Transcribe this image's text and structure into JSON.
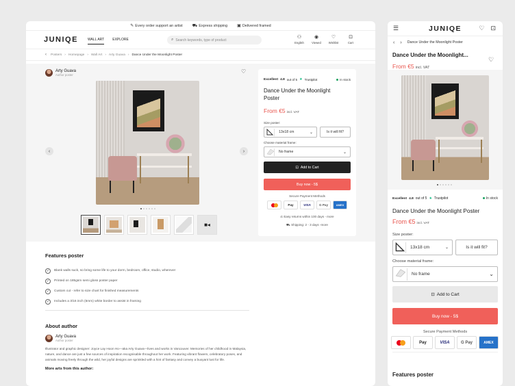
{
  "topbar": {
    "items": [
      {
        "icon": "brush-icon",
        "glyph": "✎",
        "label": "Every order support an artist"
      },
      {
        "icon": "truck-icon",
        "glyph": "⛟",
        "label": "Express shipping"
      },
      {
        "icon": "frame-icon",
        "glyph": "▣",
        "label": "Delivered framed"
      }
    ]
  },
  "nav": {
    "logo": "JUNIQE",
    "links": [
      "WALL ART",
      "EXPLORE"
    ],
    "search_placeholder": "Search keywords, type of product",
    "icons": [
      {
        "icon": "user-icon",
        "glyph": "👤",
        "label": "English"
      },
      {
        "icon": "eye-icon",
        "glyph": "◔",
        "label": "Viewed"
      },
      {
        "icon": "heart-icon",
        "glyph": "♡",
        "label": "Wishlist"
      },
      {
        "icon": "bag-icon",
        "glyph": "🛍",
        "label": "Cart"
      }
    ]
  },
  "breadcrumb": [
    "Posters",
    "Homepage",
    "Wall Art",
    "Arty Guava",
    "Dance Under the Moonlight Poster"
  ],
  "author": {
    "name": "Arty Guava",
    "role": "Author poster"
  },
  "gallery": {
    "dot_count": 6,
    "active_dot": 0,
    "thumb_count": 6
  },
  "buybox": {
    "trust_excellent": "Excellent",
    "trust_score": "4.8",
    "trust_out_of": "out of 5",
    "trust_brand": "Trustpilot",
    "stock": "In stock",
    "title": "Dance Under the Moonlight Poster",
    "price": "From €5",
    "price_note": "incl. VAT",
    "size_label": "Size poster:",
    "size_value": "13x18 cm",
    "size_help": "Is it will fit?",
    "frame_label": "Choose material frame:",
    "frame_value": "No frame",
    "add_to_cart": "Add to Cart",
    "buy_now": "Buy now - 5$",
    "payment_title": "Secure Payment Methods",
    "payments": [
      "Mastercard",
      "Apple Pay",
      "VISA",
      "G Pay",
      "AMEX"
    ],
    "returns": "Easy returns within 100 days - more",
    "shipping": "Shipping: 2 - 3 days -more"
  },
  "features": {
    "title": "Features poster",
    "items": [
      "Blank walls suck, so bring some life to your dorm, bedroom, office, studio, wherever",
      "Printed on 185gsm semi gloss poster paper",
      "Custom cut - refer to size chart for finished measurements",
      "Includes a 3/16 inch (5mm) white border to assist in framing"
    ]
  },
  "about": {
    "title": "About author",
    "name": "Arty Guava",
    "role": "Author poster",
    "bio": "Illustrator and graphic designer: Joyce Lay Hoon Ho—aka Arty Guava—lives and works in Vancouver. Memories of her childhood in Malaysia, nature, and dance are just a few sources of inspiration recognisable throughout her work. Featuring vibrant flowers, celebratory poses, and animals moving freely through the wild, her joyful designs are sprinkled with a hint of fantasy and convey a buoyant lust for life.",
    "more": "More arts from this author:"
  },
  "mobile": {
    "logo": "JUNIQE",
    "crumb": "Dance Under the Moonlight Poster",
    "title": "Dance Under the Moonlight...",
    "price": "From €5",
    "price_note": "incl. VAT",
    "box_title": "Dance Under the Moonlight Poster",
    "features_title": "Features poster"
  },
  "colors": {
    "accent": "#f0605a",
    "price": "#e8554e",
    "dark": "#222222",
    "trust": "#00b67a"
  }
}
